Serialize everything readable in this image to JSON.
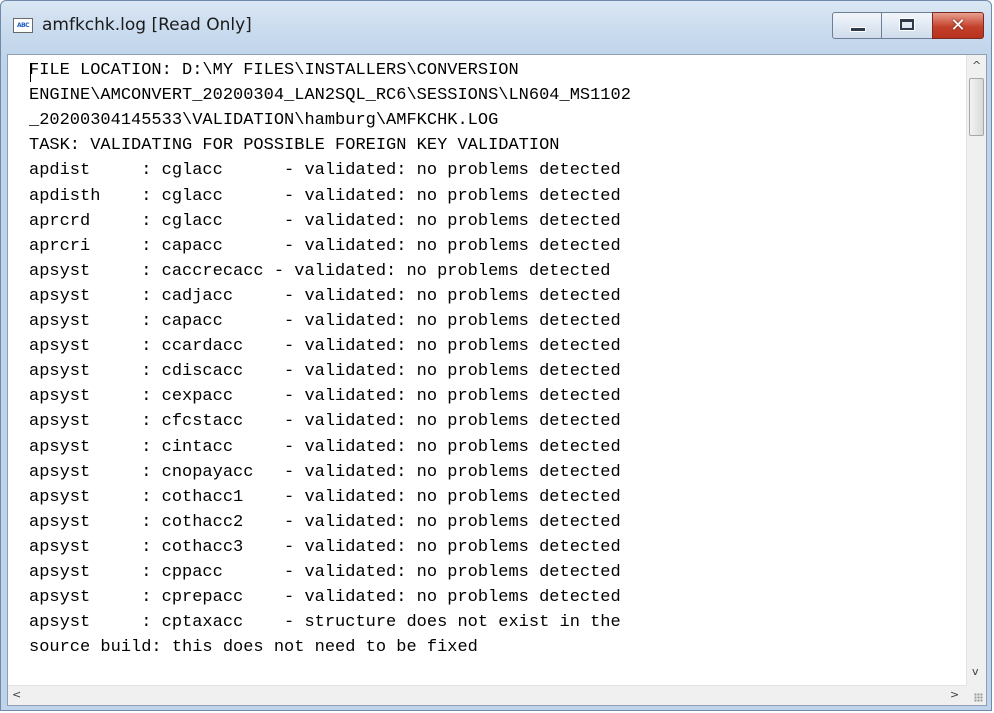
{
  "window": {
    "title": "amfkchk.log [Read Only]",
    "app_icon_text": "ABC",
    "close_glyph": "✕"
  },
  "log_lines": [
    "FILE LOCATION: D:\\MY FILES\\INSTALLERS\\CONVERSION",
    "ENGINE\\AMCONVERT_20200304_LAN2SQL_RC6\\SESSIONS\\LN604_MS1102",
    "_20200304145533\\VALIDATION\\hamburg\\AMFKCHK.LOG",
    "TASK: VALIDATING FOR POSSIBLE FOREIGN KEY VALIDATION",
    "apdist     : cglacc      - validated: no problems detected",
    "apdisth    : cglacc      - validated: no problems detected",
    "aprcrd     : cglacc      - validated: no problems detected",
    "aprcri     : capacc      - validated: no problems detected",
    "apsyst     : caccrecacc - validated: no problems detected",
    "apsyst     : cadjacc     - validated: no problems detected",
    "apsyst     : capacc      - validated: no problems detected",
    "apsyst     : ccardacc    - validated: no problems detected",
    "apsyst     : cdiscacc    - validated: no problems detected",
    "apsyst     : cexpacc     - validated: no problems detected",
    "apsyst     : cfcstacc    - validated: no problems detected",
    "apsyst     : cintacc     - validated: no problems detected",
    "apsyst     : cnopayacc   - validated: no problems detected",
    "apsyst     : cothacc1    - validated: no problems detected",
    "apsyst     : cothacc2    - validated: no problems detected",
    "apsyst     : cothacc3    - validated: no problems detected",
    "apsyst     : cppacc      - validated: no problems detected",
    "apsyst     : cprepacc    - validated: no problems detected",
    "apsyst     : cptaxacc    - structure does not exist in the",
    "source build: this does not need to be fixed"
  ],
  "scrollbars": {
    "up_arrow": "^",
    "down_arrow": "v",
    "left_arrow": "<",
    "right_arrow": ">"
  }
}
